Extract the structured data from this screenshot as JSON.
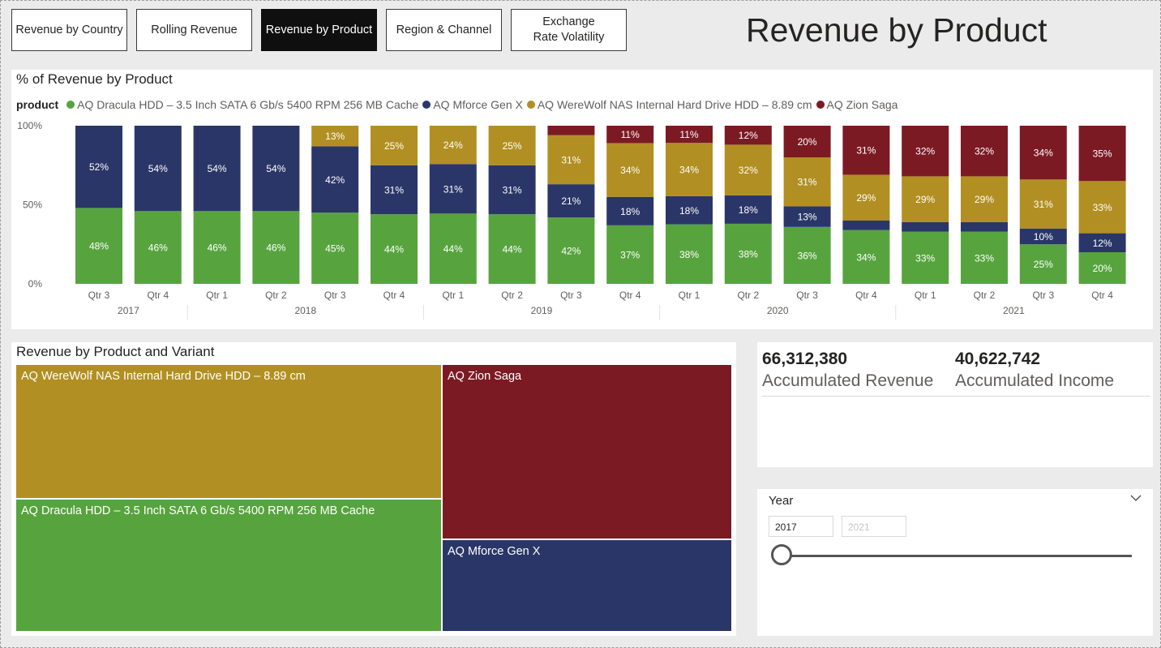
{
  "nav": {
    "buttons": [
      {
        "label": "Revenue by Country"
      },
      {
        "label": "Rolling Revenue"
      },
      {
        "label": "Revenue by Product"
      },
      {
        "label": "Region & Channel"
      },
      {
        "label": "Exchange Rate Volatility"
      }
    ],
    "active_index": 2
  },
  "page_title": "Revenue by Product",
  "colors": {
    "dracula": "#57a43e",
    "mforce": "#2b3668",
    "werewolf": "#b18f22",
    "zion": "#7c1a24"
  },
  "chart_data": {
    "type": "bar",
    "stacked": "percent",
    "title": "% of Revenue by Product",
    "legend_title": "product",
    "legend_position": "top-left",
    "y_ticks": [
      "0%",
      "50%",
      "100%"
    ],
    "ylim": [
      0,
      100
    ],
    "categories": [
      "Qtr 3",
      "Qtr 4",
      "Qtr 1",
      "Qtr 2",
      "Qtr 3",
      "Qtr 4",
      "Qtr 1",
      "Qtr 2",
      "Qtr 3",
      "Qtr 4",
      "Qtr 1",
      "Qtr 2",
      "Qtr 3",
      "Qtr 4",
      "Qtr 1",
      "Qtr 2",
      "Qtr 3",
      "Qtr 4"
    ],
    "years": [
      {
        "label": "2017",
        "count": 2
      },
      {
        "label": "2018",
        "count": 4
      },
      {
        "label": "2019",
        "count": 4
      },
      {
        "label": "2020",
        "count": 4
      },
      {
        "label": "2021",
        "count": 4
      }
    ],
    "series": [
      {
        "name": "AQ Dracula HDD – 3.5 Inch SATA 6 Gb/s 5400 RPM 256 MB Cache",
        "color": "#57a43e",
        "values": [
          48,
          46,
          46,
          46,
          45,
          44,
          44,
          44,
          42,
          37,
          38,
          38,
          36,
          34,
          33,
          33,
          25,
          20
        ]
      },
      {
        "name": "AQ Mforce Gen X",
        "color": "#2b3668",
        "values": [
          52,
          54,
          54,
          54,
          42,
          31,
          31,
          31,
          21,
          18,
          18,
          18,
          13,
          6,
          6,
          6,
          10,
          12
        ]
      },
      {
        "name": "AQ WereWolf NAS Internal Hard Drive HDD – 8.89 cm",
        "color": "#b18f22",
        "values": [
          0,
          0,
          0,
          0,
          13,
          25,
          24,
          25,
          31,
          34,
          34,
          32,
          31,
          29,
          29,
          29,
          31,
          33
        ]
      },
      {
        "name": "AQ Zion Saga",
        "color": "#7c1a24",
        "values": [
          0,
          0,
          0,
          0,
          0,
          0,
          0,
          0,
          6,
          11,
          11,
          12,
          20,
          31,
          32,
          32,
          34,
          35
        ]
      }
    ],
    "data_labels": [
      [
        "48%",
        "46%",
        "46%",
        "46%",
        "45%",
        "44%",
        "44%",
        "44%",
        "42%",
        "37%",
        "38%",
        "38%",
        "36%",
        "34%",
        "33%",
        "33%",
        "25%",
        "20%"
      ],
      [
        "52%",
        "54%",
        "54%",
        "54%",
        "42%",
        "31%",
        "31%",
        "31%",
        "21%",
        "18%",
        "18%",
        "18%",
        "13%",
        "",
        "",
        "",
        "10%",
        "12%"
      ],
      [
        "",
        "",
        "",
        "",
        "13%",
        "25%",
        "24%",
        "25%",
        "31%",
        "34%",
        "34%",
        "32%",
        "31%",
        "29%",
        "29%",
        "29%",
        "31%",
        "33%"
      ],
      [
        "",
        "",
        "",
        "",
        "",
        "",
        "",
        "",
        "",
        "11%",
        "11%",
        "12%",
        "20%",
        "31%",
        "32%",
        "32%",
        "34%",
        "35%"
      ]
    ]
  },
  "treemap": {
    "title": "Revenue by Product and Variant",
    "items": [
      {
        "label": "AQ WereWolf NAS Internal Hard Drive HDD – 8.89 cm",
        "key": "werewolf"
      },
      {
        "label": "AQ Zion Saga",
        "key": "zion"
      },
      {
        "label": "AQ Dracula HDD – 3.5 Inch SATA 6 Gb/s 5400 RPM 256 MB Cache",
        "key": "dracula"
      },
      {
        "label": "AQ Mforce Gen X",
        "key": "mforce"
      }
    ]
  },
  "kpis": [
    {
      "value": "66,312,380",
      "label": "Accumulated Revenue"
    },
    {
      "value": "40,622,742",
      "label": "Accumulated Income"
    }
  ],
  "slicer": {
    "title": "Year",
    "start": "2017",
    "end": "2021",
    "position": 0
  }
}
